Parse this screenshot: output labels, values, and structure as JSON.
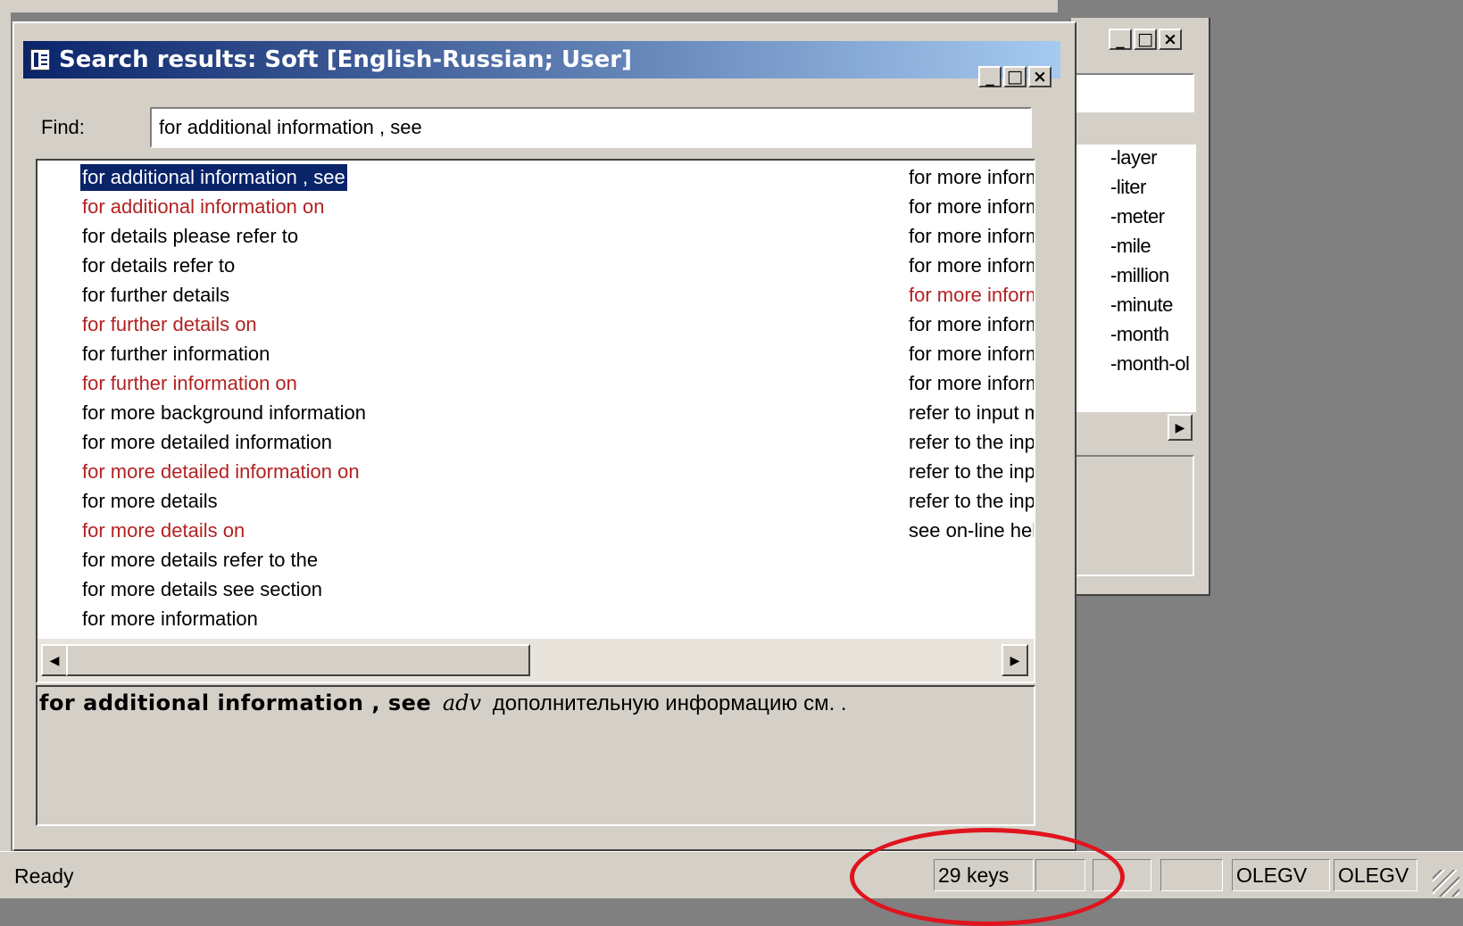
{
  "dialog": {
    "title": "Search results: Soft [English-Russian; User]",
    "controls": [
      "_",
      "□",
      "×"
    ],
    "find_label": "Find:",
    "find_value": "for additional information , see"
  },
  "results": [
    {
      "text": "for additional information , see",
      "style": "selected"
    },
    {
      "text": "for additional information on",
      "style": "red"
    },
    {
      "text": "for details please refer to",
      "style": "black"
    },
    {
      "text": "for details refer to",
      "style": "black"
    },
    {
      "text": "for further details",
      "style": "black"
    },
    {
      "text": "for further details on",
      "style": "red"
    },
    {
      "text": "for further information",
      "style": "black"
    },
    {
      "text": "for further information on",
      "style": "red"
    },
    {
      "text": "for more background information",
      "style": "black"
    },
    {
      "text": "for more detailed information",
      "style": "black"
    },
    {
      "text": "for more detailed information on",
      "style": "red"
    },
    {
      "text": "for more details",
      "style": "black"
    },
    {
      "text": "for more details on",
      "style": "red"
    },
    {
      "text": "for more details refer to the",
      "style": "black"
    },
    {
      "text": "for more details see section",
      "style": "black"
    },
    {
      "text": "for more information",
      "style": "black"
    }
  ],
  "results_col2": [
    {
      "text": "for more inform",
      "style": "black"
    },
    {
      "text": "for more inform",
      "style": "black"
    },
    {
      "text": "for more inform",
      "style": "black"
    },
    {
      "text": "for more inform",
      "style": "black"
    },
    {
      "text": "for more inform",
      "style": "red"
    },
    {
      "text": "for more inform",
      "style": "black"
    },
    {
      "text": "for more inform",
      "style": "black"
    },
    {
      "text": "for more inform",
      "style": "black"
    },
    {
      "text": "refer to input m",
      "style": "black"
    },
    {
      "text": "refer to the inp",
      "style": "black"
    },
    {
      "text": "refer to the inp",
      "style": "black"
    },
    {
      "text": "refer to the inp",
      "style": "black"
    },
    {
      "text": "see on-line hel",
      "style": "black"
    }
  ],
  "detail": {
    "headword": "for additional information , see",
    "pos": "adv",
    "translation": "дополнительную информацию см. ."
  },
  "background_window": {
    "controls": [
      "_",
      "□",
      "×"
    ],
    "items": [
      "-layer",
      "-liter",
      "-meter",
      "-mile",
      "-million",
      "-minute",
      "-month",
      "-month-ol"
    ]
  },
  "statusbar": {
    "text": "Ready",
    "keys": "29 keys",
    "user1": "OLEGV",
    "user2": "OLEGV"
  },
  "colors": {
    "title_start": "#0a246a",
    "title_end": "#a6caf0",
    "red_entry": "#b22222",
    "highlight_ring": "#e0141e"
  },
  "icons": {
    "scroll_left": "◀",
    "scroll_right": "▶"
  }
}
